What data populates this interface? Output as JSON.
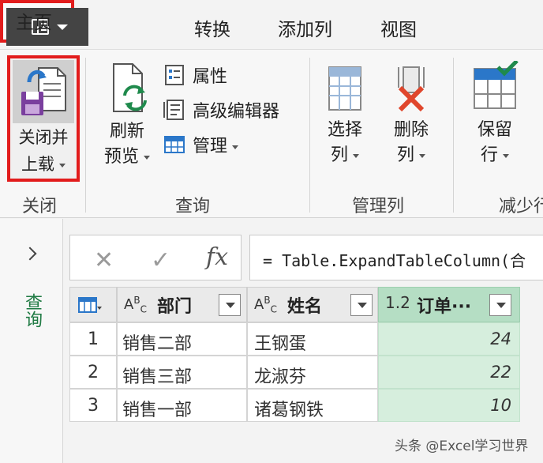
{
  "tabs": {
    "home": "主页",
    "transform": "转换",
    "add_column": "添加列",
    "view": "视图"
  },
  "ribbon": {
    "close_group": {
      "button_line1": "关闭并",
      "button_line2": "上载",
      "label": "关闭"
    },
    "query_group": {
      "refresh_line1": "刷新",
      "refresh_line2": "预览",
      "properties": "属性",
      "advanced_editor": "高级编辑器",
      "manage": "管理",
      "label": "查询"
    },
    "manage_columns_group": {
      "choose_line1": "选择",
      "choose_line2": "列",
      "remove_line1": "删除",
      "remove_line2": "列",
      "label": "管理列"
    },
    "reduce_rows_group": {
      "keep_line1": "保留",
      "keep_line2": "行",
      "label": "减少行"
    }
  },
  "query_pane": {
    "label": "查询"
  },
  "formula_bar": {
    "cancel": "✕",
    "confirm": "✓",
    "fx": "fx",
    "formula": "= Table.ExpandTableColumn(合"
  },
  "grid": {
    "columns": [
      {
        "type": "ABC",
        "name": "部门"
      },
      {
        "type": "ABC",
        "name": "姓名"
      },
      {
        "type": "1.2",
        "name": "订单···"
      }
    ],
    "rows": [
      {
        "index": "1",
        "dept": "销售二部",
        "name": "王钢蛋",
        "orders": "24"
      },
      {
        "index": "2",
        "dept": "销售三部",
        "name": "龙淑芬",
        "orders": "22"
      },
      {
        "index": "3",
        "dept": "销售一部",
        "name": "诸葛钢铁",
        "orders": "10"
      }
    ]
  },
  "watermark": "头条 @Excel学习世界",
  "colors": {
    "highlight_red": "#e21c1c",
    "query_green": "#1f7a43",
    "selected_column": "#b5dec4"
  }
}
